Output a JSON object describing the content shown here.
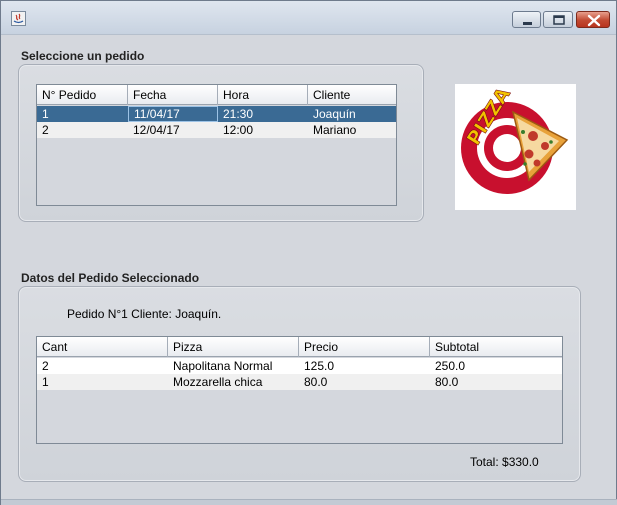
{
  "window": {
    "controls": [
      "minimize-icon",
      "maximize-icon",
      "close-icon"
    ]
  },
  "orders_section": {
    "title": "Seleccione un pedido",
    "columns": [
      "N° Pedido",
      "Fecha",
      "Hora",
      "Cliente"
    ],
    "rows": [
      [
        "1",
        "11/04/17",
        "21:30",
        "Joaquín"
      ],
      [
        "2",
        "12/04/17",
        "12:00",
        "Mariano"
      ]
    ],
    "selected_row": 0
  },
  "logo": {
    "text": "PIZZA",
    "colors": {
      "ring": "#c8102e",
      "text": "#f2c200",
      "crust": "#e8a23a",
      "cheese": "#f6d9a0",
      "pepperoni": "#c0392b"
    }
  },
  "details_section": {
    "title": "Datos del Pedido Seleccionado",
    "pedido_label": "Pedido N°1 Cliente: Joaquín.",
    "columns": [
      "Cant",
      "Pizza",
      "Precio",
      "Subtotal"
    ],
    "rows": [
      [
        "2",
        "Napolitana Normal",
        "125.0",
        "250.0"
      ],
      [
        "1",
        "Mozzarella chica",
        "80.0",
        "80.0"
      ]
    ],
    "total_label": "Total: $330.0"
  },
  "colors": {
    "background": "#d4d7dd",
    "selection": "#3a6a94"
  }
}
